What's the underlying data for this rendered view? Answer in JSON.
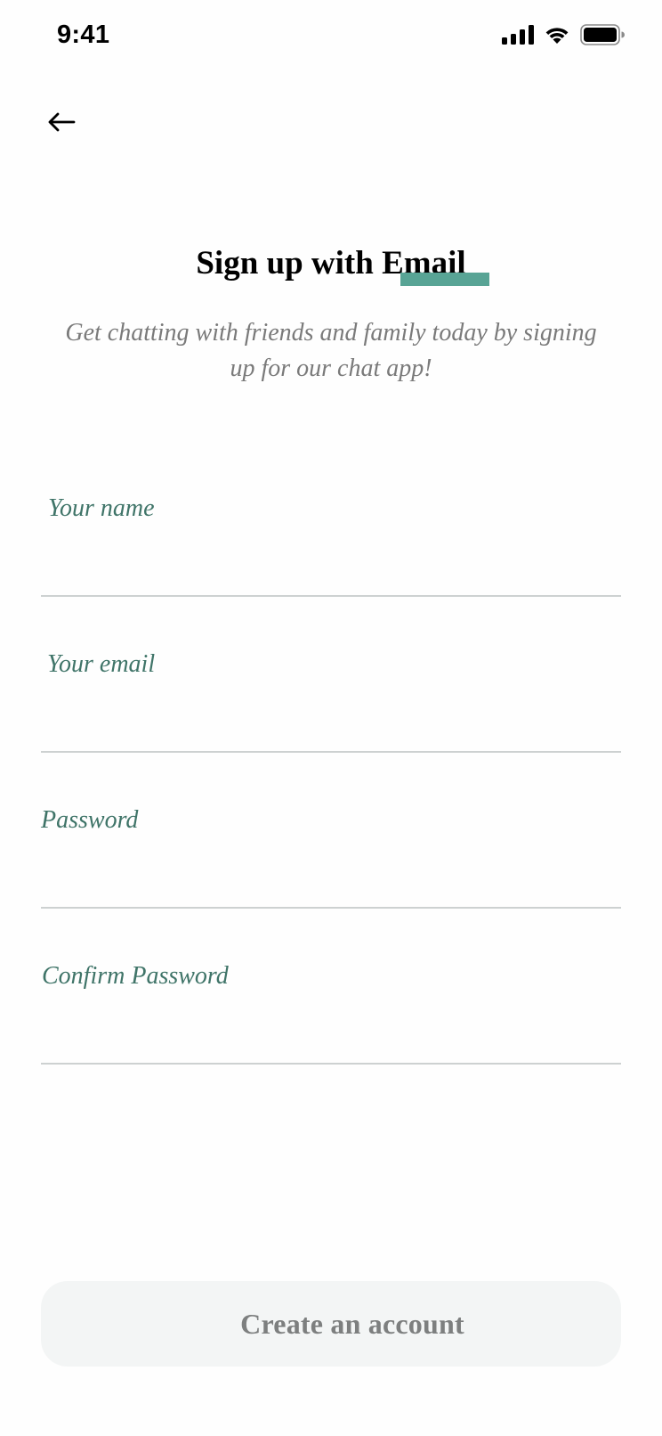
{
  "status_bar": {
    "time": "9:41",
    "icons": [
      "cellular-signal-icon",
      "wifi-icon",
      "battery-icon"
    ]
  },
  "nav": {
    "back_icon": "arrow-left-icon"
  },
  "header": {
    "title": "Sign up with Email",
    "subtitle": "Get chatting with friends and family today by signing up for our chat app!",
    "highlight_color": "#58a495"
  },
  "form": {
    "fields": [
      {
        "label": "Your name",
        "value": ""
      },
      {
        "label": "Your email",
        "value": ""
      },
      {
        "label": "Password",
        "value": ""
      },
      {
        "label": "Confirm Password",
        "value": ""
      }
    ],
    "label_color": "#3f7468",
    "divider_color": "#cdd1d1"
  },
  "actions": {
    "create_account_label": "Create an account",
    "button_bg": "#f3f5f5",
    "button_text_color": "#7d7f7f"
  }
}
